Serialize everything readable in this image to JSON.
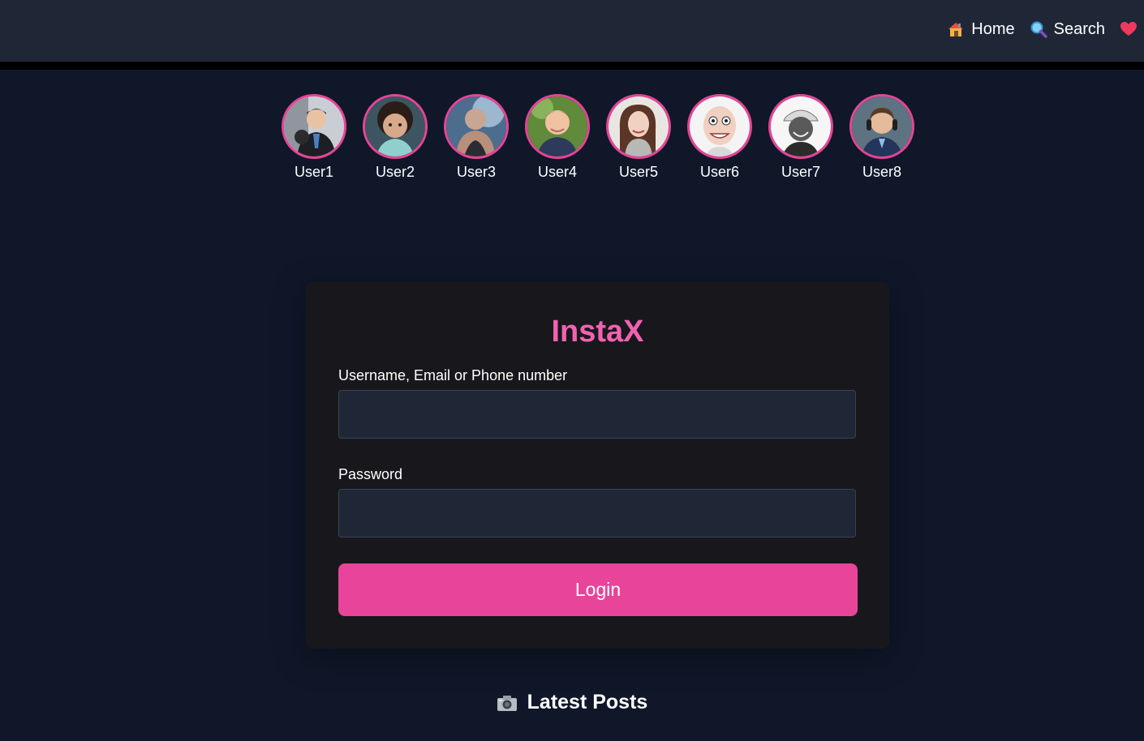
{
  "nav": {
    "home_label": "Home",
    "search_label": "Search"
  },
  "stories": [
    {
      "name": "User1"
    },
    {
      "name": "User2"
    },
    {
      "name": "User3"
    },
    {
      "name": "User4"
    },
    {
      "name": "User5"
    },
    {
      "name": "User6"
    },
    {
      "name": "User7"
    },
    {
      "name": "User8"
    }
  ],
  "login": {
    "brand": "InstaX",
    "username_label": "Username, Email or Phone number",
    "username_value": "",
    "password_label": "Password",
    "password_value": "",
    "submit_label": "Login"
  },
  "feed": {
    "title": "Latest Posts"
  },
  "colors": {
    "accent": "#e8449a",
    "brand_text": "#f062b1",
    "background": "#0f1729",
    "topbar": "#1f2737",
    "card": "#18181c"
  },
  "icons": {
    "home": "house-icon",
    "search": "magnifier-icon",
    "heart": "heart-icon",
    "latest": "camera-icon"
  }
}
